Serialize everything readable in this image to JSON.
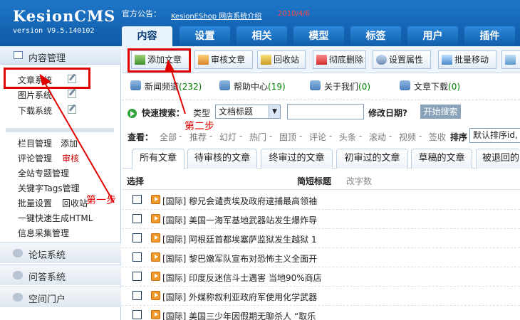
{
  "header": {
    "logo": "KesionCMS",
    "version": "version V9.5.140102",
    "notice_label": "官方公告：",
    "notice_link": "KesionEShop 网店系统介绍",
    "notice_date": "2010/4/6",
    "tabs": [
      "内容",
      "设置",
      "相关",
      "模型",
      "标签",
      "用户",
      "插件"
    ],
    "active_tab": "内容"
  },
  "sidebar": {
    "title": "内容管理",
    "systems": [
      "文章系统",
      "图片系统",
      "下载系统"
    ],
    "manage": {
      "column": "栏目管理",
      "column_add": "添加",
      "comment": "评论管理",
      "comment_audit": "审核",
      "special": "全站专题管理",
      "tags": "关键字Tags管理",
      "batch": "批量设置",
      "recycle": "回收站",
      "html": "一键快速生成HTML",
      "collect": "信息采集管理"
    },
    "sections": [
      "论坛系统",
      "问答系统",
      "空间门户"
    ]
  },
  "toolbar": {
    "buttons": [
      "添加文章",
      "审核文章",
      "回收站",
      "彻底删除",
      "设置属性",
      "批量移动"
    ]
  },
  "channels": [
    {
      "name": "新闻频道",
      "count": "(232)"
    },
    {
      "name": "帮助中心",
      "count": "(19)"
    },
    {
      "name": "关于我们",
      "count": "(0)"
    },
    {
      "name": "文章下载",
      "count": "(0)"
    }
  ],
  "search": {
    "label": "快速搜索：",
    "type_label": "类型",
    "type_value": "文档标题",
    "modify_date_label": "修改日期?",
    "button": "开始搜索"
  },
  "filter": {
    "label": "查看：",
    "items": [
      "全部",
      "推荐",
      "幻灯",
      "热门",
      "固顶",
      "评论",
      "头条",
      "滚动",
      "视频",
      "签收"
    ],
    "sort_label": "排序",
    "sort_value": "默认排序id,"
  },
  "article_tabs": [
    "所有文章",
    "待审核的文章",
    "终审过的文章",
    "初审过的文章",
    "草稿的文章",
    "被退回的"
  ],
  "list": {
    "col_select": "选择",
    "col_title": "简短标题",
    "col_count": "改字数",
    "rows": [
      "[国际] 穆兄会谴责埃及政府逮捕最高领袖",
      "[国际] 美国一海军基地武器站发生爆炸导",
      "[国际] 阿根廷首都埃塞萨监狱发生越狱 1",
      "[国际] 黎巴嫩军队宣布对恐怖主义全面开",
      "[国际] 印度反迷信斗士遇害 当地90%商店",
      "[国际] 外媒称叙利亚政府军使用化学武器",
      "[国际] 美国三少年因假期无聊杀人 “取乐"
    ]
  },
  "annotations": {
    "step1": "第一步",
    "step2": "第二步"
  },
  "colors": {
    "header_blue": "#1565b8",
    "annotation_red": "#e00000",
    "count_green": "#008000"
  }
}
